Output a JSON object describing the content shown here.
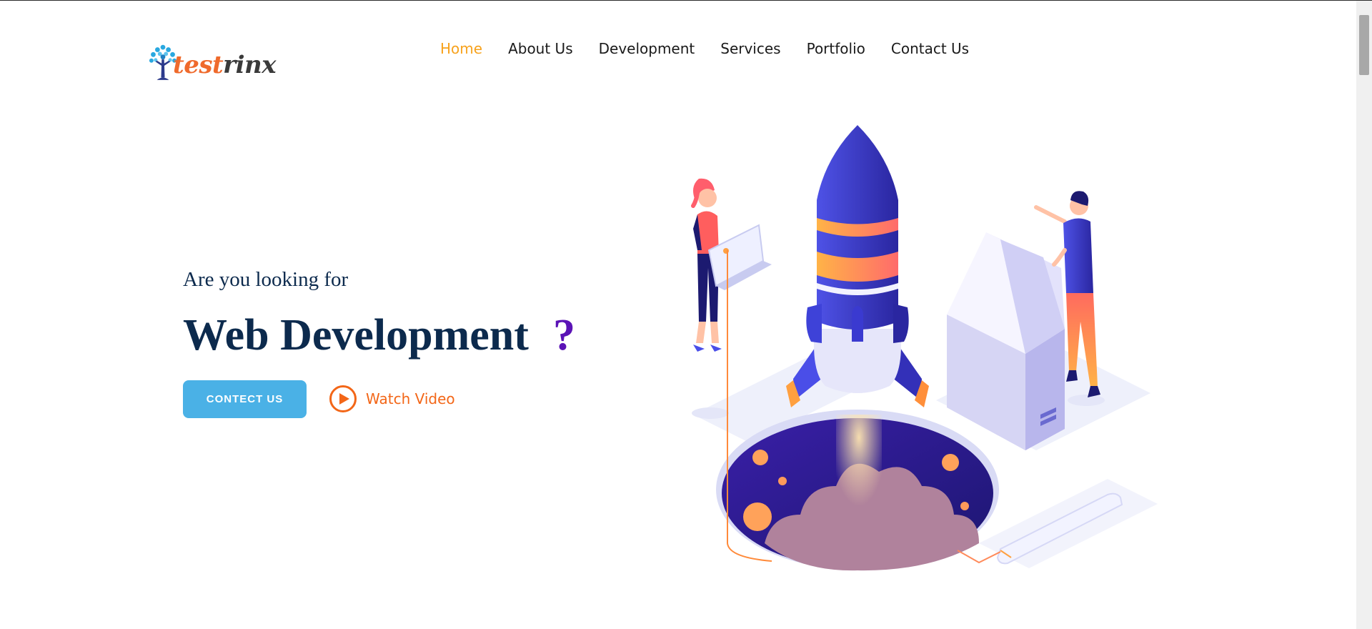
{
  "logo": {
    "text_part1": "test",
    "text_part2": "rinx",
    "icon": "tree-icon"
  },
  "nav": {
    "items": [
      {
        "label": "Home",
        "active": true
      },
      {
        "label": "About Us",
        "active": false
      },
      {
        "label": "Development",
        "active": false
      },
      {
        "label": "Services",
        "active": false
      },
      {
        "label": "Portfolio",
        "active": false
      },
      {
        "label": "Contact Us",
        "active": false
      }
    ]
  },
  "hero": {
    "pre_title": "Are you looking for",
    "title": "Web Development",
    "question_mark": "?",
    "cta_label": "CONTECT US",
    "video_label": "Watch Video",
    "video_icon": "play-circle-icon"
  },
  "colors": {
    "nav_active": "#f7a21c",
    "title": "#0c2a4d",
    "question": "#5b13b6",
    "cta_bg": "#4ab1e6",
    "video": "#f36617"
  }
}
